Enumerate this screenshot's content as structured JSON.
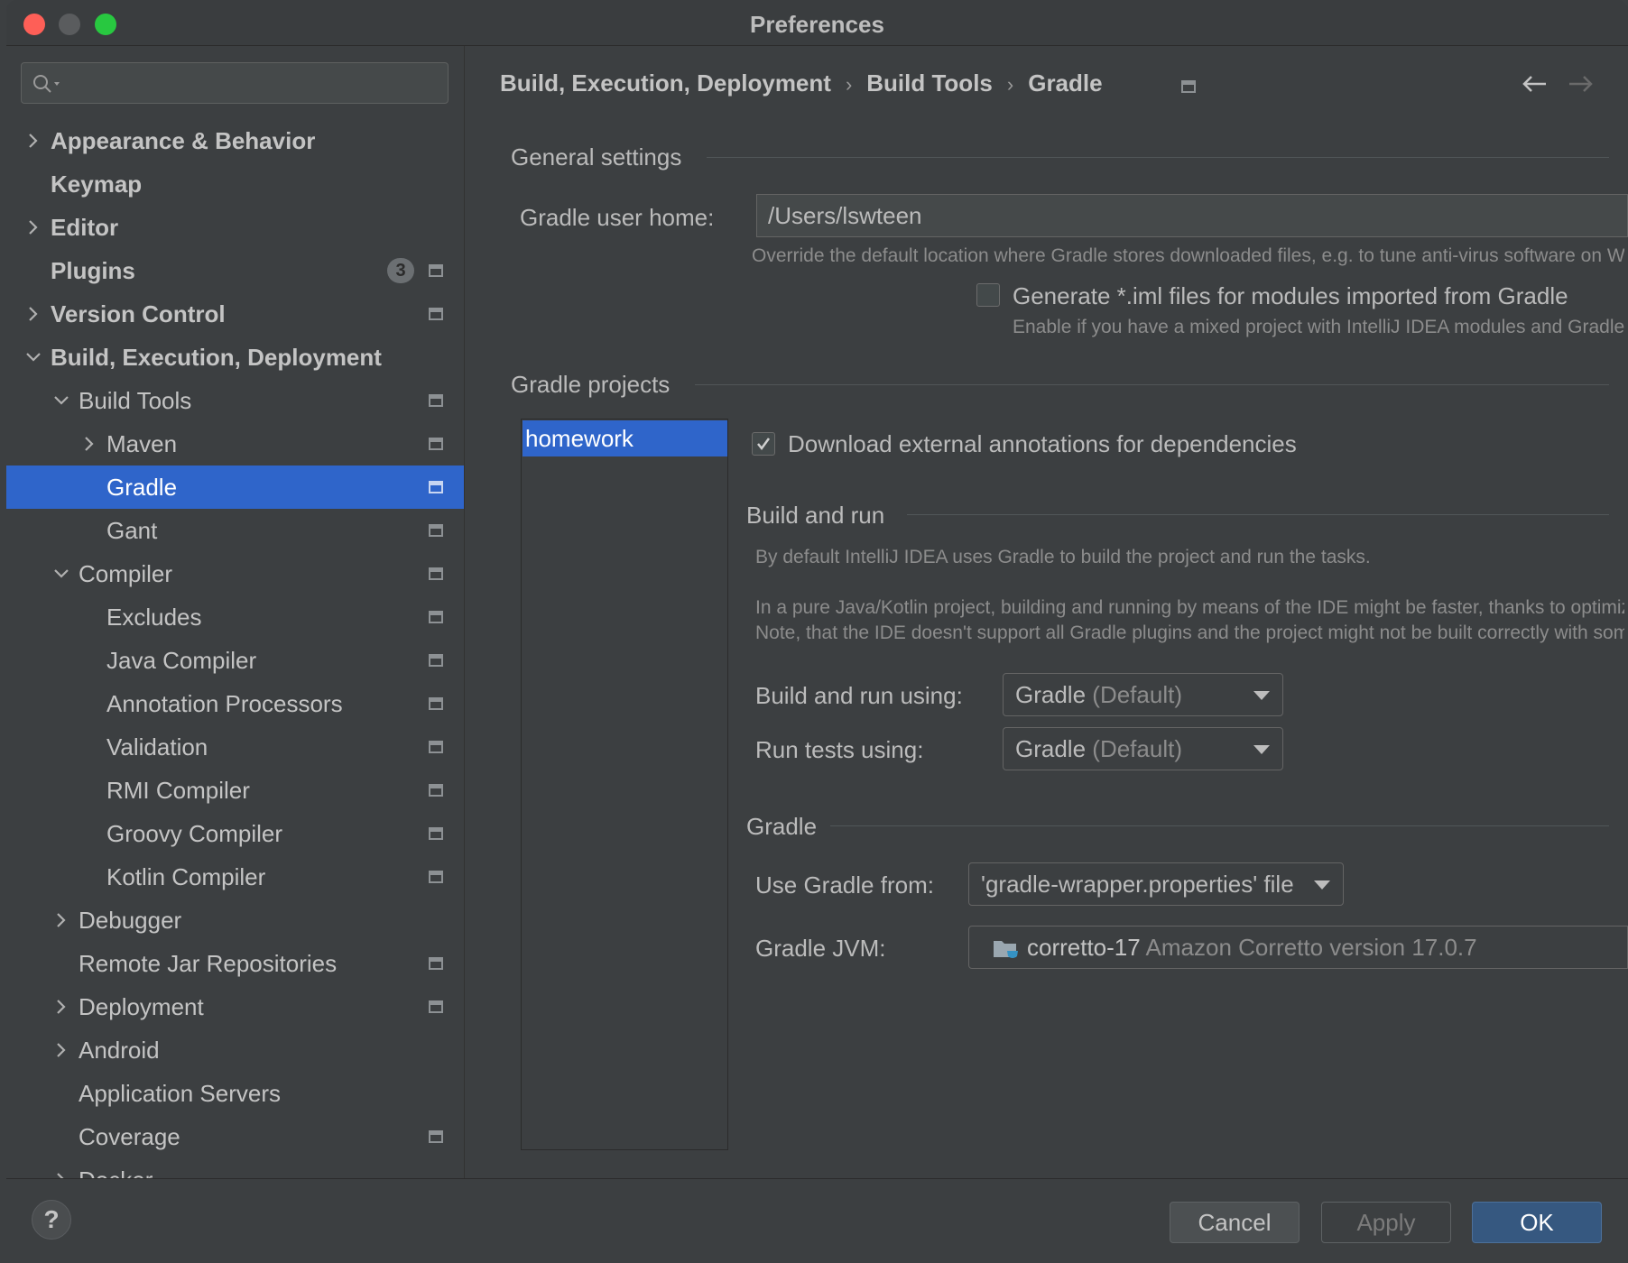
{
  "window": {
    "title": "Preferences"
  },
  "search": {
    "placeholder": ""
  },
  "sidebar": {
    "items": [
      {
        "label": "Appearance & Behavior",
        "level": 0,
        "bold": true,
        "expander": "collapsed",
        "project": false
      },
      {
        "label": "Keymap",
        "level": 0,
        "bold": true,
        "expander": "none",
        "project": false
      },
      {
        "label": "Editor",
        "level": 0,
        "bold": true,
        "expander": "collapsed",
        "project": false
      },
      {
        "label": "Plugins",
        "level": 0,
        "bold": true,
        "expander": "none",
        "project": true,
        "badge": "3"
      },
      {
        "label": "Version Control",
        "level": 0,
        "bold": true,
        "expander": "collapsed",
        "project": true
      },
      {
        "label": "Build, Execution, Deployment",
        "level": 0,
        "bold": true,
        "expander": "expanded",
        "project": false
      },
      {
        "label": "Build Tools",
        "level": 1,
        "bold": false,
        "expander": "expanded",
        "project": true
      },
      {
        "label": "Maven",
        "level": 2,
        "bold": false,
        "expander": "collapsed",
        "project": true
      },
      {
        "label": "Gradle",
        "level": 2,
        "bold": false,
        "expander": "none",
        "project": true,
        "selected": true
      },
      {
        "label": "Gant",
        "level": 2,
        "bold": false,
        "expander": "none",
        "project": true
      },
      {
        "label": "Compiler",
        "level": 1,
        "bold": false,
        "expander": "expanded",
        "project": true
      },
      {
        "label": "Excludes",
        "level": 2,
        "bold": false,
        "expander": "none",
        "project": true
      },
      {
        "label": "Java Compiler",
        "level": 2,
        "bold": false,
        "expander": "none",
        "project": true
      },
      {
        "label": "Annotation Processors",
        "level": 2,
        "bold": false,
        "expander": "none",
        "project": true
      },
      {
        "label": "Validation",
        "level": 2,
        "bold": false,
        "expander": "none",
        "project": true
      },
      {
        "label": "RMI Compiler",
        "level": 2,
        "bold": false,
        "expander": "none",
        "project": true
      },
      {
        "label": "Groovy Compiler",
        "level": 2,
        "bold": false,
        "expander": "none",
        "project": true
      },
      {
        "label": "Kotlin Compiler",
        "level": 2,
        "bold": false,
        "expander": "none",
        "project": true
      },
      {
        "label": "Debugger",
        "level": 1,
        "bold": false,
        "expander": "collapsed",
        "project": false
      },
      {
        "label": "Remote Jar Repositories",
        "level": 1,
        "bold": false,
        "expander": "none",
        "project": true
      },
      {
        "label": "Deployment",
        "level": 1,
        "bold": false,
        "expander": "collapsed",
        "project": true
      },
      {
        "label": "Android",
        "level": 1,
        "bold": false,
        "expander": "collapsed",
        "project": false
      },
      {
        "label": "Application Servers",
        "level": 1,
        "bold": false,
        "expander": "none",
        "project": false
      },
      {
        "label": "Coverage",
        "level": 1,
        "bold": false,
        "expander": "none",
        "project": true
      },
      {
        "label": "Docker",
        "level": 1,
        "bold": false,
        "expander": "collapsed",
        "project": false
      }
    ]
  },
  "breadcrumb": {
    "items": [
      "Build, Execution, Deployment",
      "Build Tools",
      "Gradle"
    ]
  },
  "general": {
    "section": "General settings",
    "user_home_label": "Gradle user home:",
    "user_home_value": "/Users/lswteen",
    "user_home_hint": "Override the default location where Gradle stores downloaded files, e.g. to tune anti-virus software on Windows",
    "iml_label": "Generate *.iml files for modules imported from Gradle",
    "iml_checked": false,
    "iml_hint": "Enable if you have a mixed project with IntelliJ IDEA modules and Gradle modules so that it could be shared via VCS"
  },
  "projects": {
    "section": "Gradle projects",
    "list": [
      "homework"
    ],
    "download_annotations_label": "Download external annotations for dependencies",
    "download_annotations_checked": true
  },
  "build_run": {
    "section": "Build and run",
    "hint1": "By default IntelliJ IDEA uses Gradle to build the project and run the tasks.",
    "hint2": "In a pure Java/Kotlin project, building and running by means of the IDE might be faster, thanks to optimizations.",
    "hint3": "Note, that the IDE doesn't support all Gradle plugins and the project might not be built correctly with some of them.",
    "build_using_label": "Build and run using:",
    "build_using_value": "Gradle",
    "build_using_suffix": "(Default)",
    "tests_using_label": "Run tests using:",
    "tests_using_value": "Gradle",
    "tests_using_suffix": "(Default)"
  },
  "gradle": {
    "section": "Gradle",
    "use_from_label": "Use Gradle from:",
    "use_from_value": "'gradle-wrapper.properties' file",
    "jvm_label": "Gradle JVM:",
    "jvm_name": "corretto-17",
    "jvm_desc": "Amazon Corretto version 17.0.7"
  },
  "footer": {
    "help": "?",
    "cancel": "Cancel",
    "apply": "Apply",
    "ok": "OK"
  }
}
